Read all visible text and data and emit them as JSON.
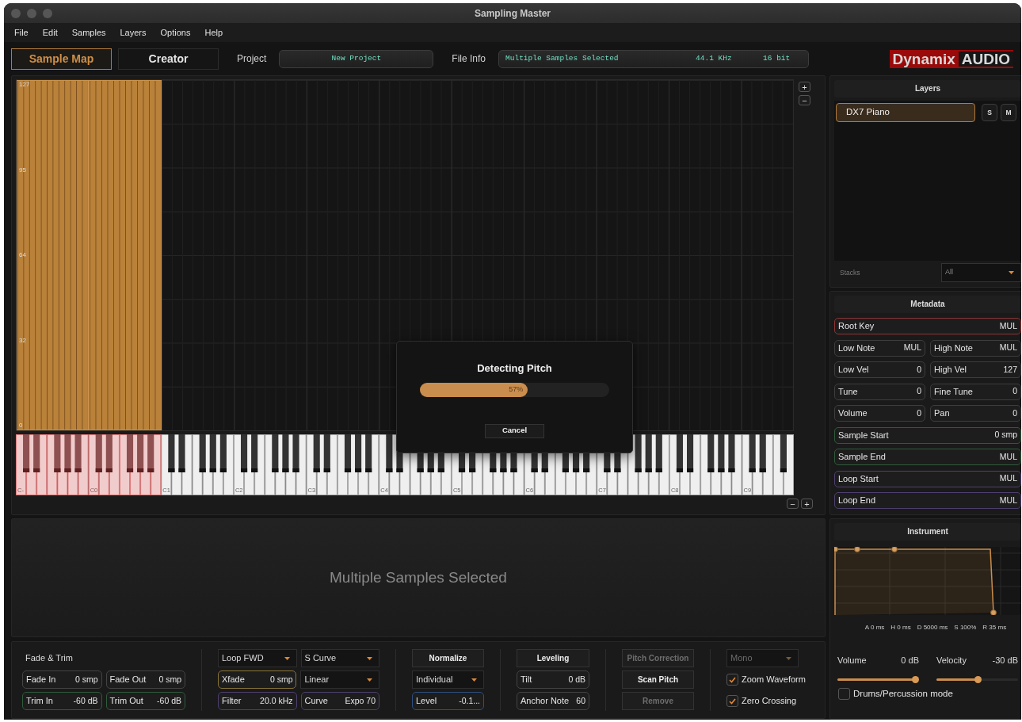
{
  "window": {
    "title": "Sampling Master"
  },
  "menu": [
    "File",
    "Edit",
    "Samples",
    "Layers",
    "Options",
    "Help"
  ],
  "toolbar": {
    "tabs": [
      {
        "label": "Sample Map",
        "selected": true
      },
      {
        "label": "Creator",
        "selected": false
      }
    ],
    "project": {
      "label": "Project",
      "value": "New Project"
    },
    "file_info": {
      "label": "File Info",
      "name": "Multiple Samples Selected",
      "rate": "44.1 KHz",
      "depth": "16 bit"
    },
    "logo": [
      "Dynamix",
      "AUDIO"
    ]
  },
  "sample_map": {
    "velocity_labels": [
      "127",
      "95",
      "64",
      "32",
      "0"
    ],
    "zoom_top": [
      "+",
      "−"
    ],
    "zoom_bottom": [
      "−",
      "+"
    ]
  },
  "keyboard": {
    "octaves": [
      {
        "label": "C-",
        "selected": true
      },
      {
        "label": "C0",
        "selected": true
      },
      {
        "label": "C1",
        "selected": false
      },
      {
        "label": "C2",
        "selected": false
      },
      {
        "label": "C3",
        "selected": false
      },
      {
        "label": "C4",
        "selected": false
      },
      {
        "label": "C5",
        "selected": false
      },
      {
        "label": "C6",
        "selected": false
      },
      {
        "label": "C7",
        "selected": false
      },
      {
        "label": "C8",
        "selected": false
      },
      {
        "label": "C9",
        "selected": false
      }
    ]
  },
  "progress_dialog": {
    "title": "Detecting Pitch",
    "level": 0.57,
    "reading": "57%",
    "button": "Cancel"
  },
  "layers": {
    "title": "Layers",
    "items": [
      {
        "name": "DX7 Piano",
        "selected": true,
        "solo": "S",
        "mute": "M"
      }
    ],
    "stacks_label": "Stacks",
    "stacks_value": "All"
  },
  "metadata": {
    "title": "Metadata",
    "rows": [
      [
        {
          "label": "Root Key",
          "value": "MUL",
          "color": "#8e3434"
        }
      ],
      [
        {
          "label": "Low Note",
          "value": "MUL",
          "color": "#3d3d3d"
        },
        {
          "label": "High Note",
          "value": "MUL",
          "color": "#3d3d3d"
        }
      ],
      [
        {
          "label": "Low Vel",
          "value": "0",
          "color": "#3d3d3d"
        },
        {
          "label": "High Vel",
          "value": "127",
          "color": "#3d3d3d"
        }
      ],
      [
        {
          "label": "Tune",
          "value": "0",
          "color": "#3d3d3d"
        },
        {
          "label": "Fine Tune",
          "value": "0",
          "color": "#3d3d3d"
        }
      ],
      [
        {
          "label": "Volume",
          "value": "0",
          "color": "#3d3d3d"
        },
        {
          "label": "Pan",
          "value": "0",
          "color": "#3d3d3d"
        }
      ],
      [
        {
          "label": "Sample Start",
          "value": "0 smp",
          "color": "#2f5a3a"
        }
      ],
      [
        {
          "label": "Sample End",
          "value": "MUL",
          "color": "#2f5a3a"
        }
      ],
      [
        {
          "label": "Loop Start",
          "value": "MUL",
          "color": "#4e3f6e"
        }
      ],
      [
        {
          "label": "Loop End",
          "value": "MUL",
          "color": "#4e3f6e"
        }
      ]
    ]
  },
  "waveform": {
    "message": "Multiple Samples Selected"
  },
  "controls": {
    "sections": [
      {
        "title": "Fade & Trim",
        "rows": [
          [
            {
              "kind": "field",
              "label": "Fade In",
              "value": "0 smp",
              "color": "#444444"
            },
            {
              "kind": "field",
              "label": "Fade Out",
              "value": "0 smp",
              "color": "#444444"
            }
          ],
          [
            {
              "kind": "field",
              "label": "Trim In",
              "value": "-60 dB",
              "color": "#2f5a3a"
            },
            {
              "kind": "field",
              "label": "Trim Out",
              "value": "-60 dB",
              "color": "#2f5a3a"
            }
          ]
        ]
      },
      {
        "rows": [
          [
            {
              "kind": "select",
              "value": "Loop FWD",
              "disabled": false
            },
            {
              "kind": "select",
              "value": "S Curve",
              "disabled": false
            }
          ],
          [
            {
              "kind": "field",
              "label": "Xfade",
              "value": "0 smp",
              "color": "#8a7438"
            },
            {
              "kind": "select",
              "value": "Linear",
              "disabled": false
            }
          ],
          [
            {
              "kind": "field",
              "label": "Filter",
              "value": "20.0 kHz",
              "color": "#4e3f6e"
            },
            {
              "kind": "field",
              "label": "Curve",
              "value": "Expo 70",
              "color": "#4e3f6e"
            }
          ]
        ]
      },
      {
        "rows": [
          [
            {
              "kind": "button",
              "label": "Normalize",
              "disabled": false
            }
          ],
          [
            {
              "kind": "select",
              "value": "Individual",
              "disabled": false
            }
          ],
          [
            {
              "kind": "field",
              "label": "Level",
              "value": "-0.1...",
              "color": "#2e4f80"
            }
          ]
        ]
      },
      {
        "rows": [
          [
            {
              "kind": "button",
              "label": "Leveling",
              "disabled": false
            }
          ],
          [
            {
              "kind": "field",
              "label": "Tilt",
              "value": "0 dB",
              "color": "#444444"
            }
          ],
          [
            {
              "kind": "field",
              "label": "Anchor Note",
              "value": "60",
              "color": "#444444"
            }
          ]
        ]
      },
      {
        "rows": [
          [
            {
              "kind": "button",
              "label": "Pitch Correction",
              "disabled": true
            }
          ],
          [
            {
              "kind": "button",
              "label": "Scan Pitch",
              "disabled": false
            }
          ],
          [
            {
              "kind": "button",
              "label": "Remove",
              "disabled": true
            }
          ]
        ]
      },
      {
        "rows": [
          [
            {
              "kind": "select",
              "value": "Mono",
              "disabled": true
            }
          ],
          [
            {
              "kind": "checkbox",
              "label": "Zoom Waveform",
              "checked": true
            }
          ],
          [
            {
              "kind": "checkbox",
              "label": "Zero Crossing",
              "checked": true
            }
          ]
        ]
      }
    ]
  },
  "instrument": {
    "title": "Instrument",
    "envelope_labels": [
      "A 0 ms",
      "H 0 ms",
      "D 5000 ms",
      "S 100%",
      "R 35 ms"
    ],
    "sliders": [
      {
        "label": "Volume",
        "reading": "0 dB",
        "level": 0.97
      },
      {
        "label": "Velocity",
        "reading": "-30 dB",
        "level": 0.5
      }
    ],
    "drums_mode": {
      "label": "Drums/Percussion mode",
      "checked": false
    }
  }
}
